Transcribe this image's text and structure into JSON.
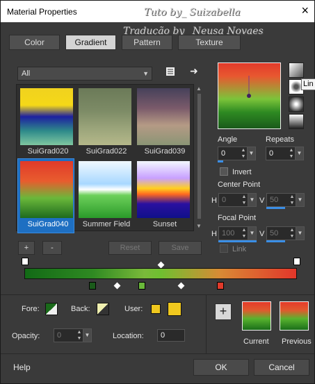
{
  "window": {
    "title": "Material Properties",
    "close_icon": "×"
  },
  "watermarks": [
    "Tuto by_ Suizabella",
    "Tradução by_ Neusa Novaes"
  ],
  "tabs": [
    {
      "label": "Color"
    },
    {
      "label": "Gradient",
      "active": true
    },
    {
      "label": "Pattern"
    },
    {
      "label": "Texture"
    }
  ],
  "category_select": {
    "value": "All"
  },
  "gradients": [
    {
      "label": "SuiGrad020",
      "colors": [
        "#f0d21e",
        "#f5d818",
        "#1d20a0",
        "#2e8a8a",
        "#7fc7a0"
      ]
    },
    {
      "label": "SuiGrad022",
      "colors": [
        "#6b7a58",
        "#7d8b66",
        "#9aa47a",
        "#b5b88a"
      ]
    },
    {
      "label": "SuiGrad039",
      "colors": [
        "#46415a",
        "#7a5a6a",
        "#b59a85",
        "#8a9575"
      ]
    },
    {
      "label": "SuiGrad040",
      "colors": [
        "#e03a2a",
        "#e85c2e",
        "#6ab83a",
        "#1e6a1e"
      ],
      "selected": true
    },
    {
      "label": "Summer Field",
      "colors": [
        "#f0f8ff",
        "#a8d8ff",
        "#ffffff",
        "#6dd05a",
        "#2a9a2a"
      ]
    },
    {
      "label": "Sunset",
      "colors": [
        "#f3f8ff",
        "#c8a0ff",
        "#ffd020",
        "#ff6a20",
        "#2a10a0",
        "#10108a"
      ]
    }
  ],
  "buttons": {
    "add": "+",
    "remove": "-",
    "reset": "Reset",
    "save": "Save"
  },
  "angle": {
    "label": "Angle",
    "value": "0"
  },
  "repeats": {
    "label": "Repeats",
    "value": "0"
  },
  "invert": {
    "label": "Invert"
  },
  "center_point": {
    "label": "Center Point",
    "h_label": "H",
    "h_value": "0",
    "v_label": "V",
    "v_value": "50"
  },
  "focal_point": {
    "label": "Focal Point",
    "h_label": "H",
    "h_value": "100",
    "v_label": "V",
    "v_value": "50"
  },
  "link": {
    "label": "Link"
  },
  "tooltip": "Lin",
  "bottom": {
    "fore_label": "Fore:",
    "back_label": "Back:",
    "user_label": "User:",
    "opacity_label": "Opacity:",
    "opacity_value": "0",
    "location_label": "Location:",
    "location_value": "0",
    "current_label": "Current",
    "previous_label": "Previous",
    "add_plus": "+"
  },
  "footer": {
    "help": "Help",
    "ok": "OK",
    "cancel": "Cancel"
  },
  "colors": {
    "accent": "#1e6fc2",
    "user_yellow": "#f0c81e"
  }
}
